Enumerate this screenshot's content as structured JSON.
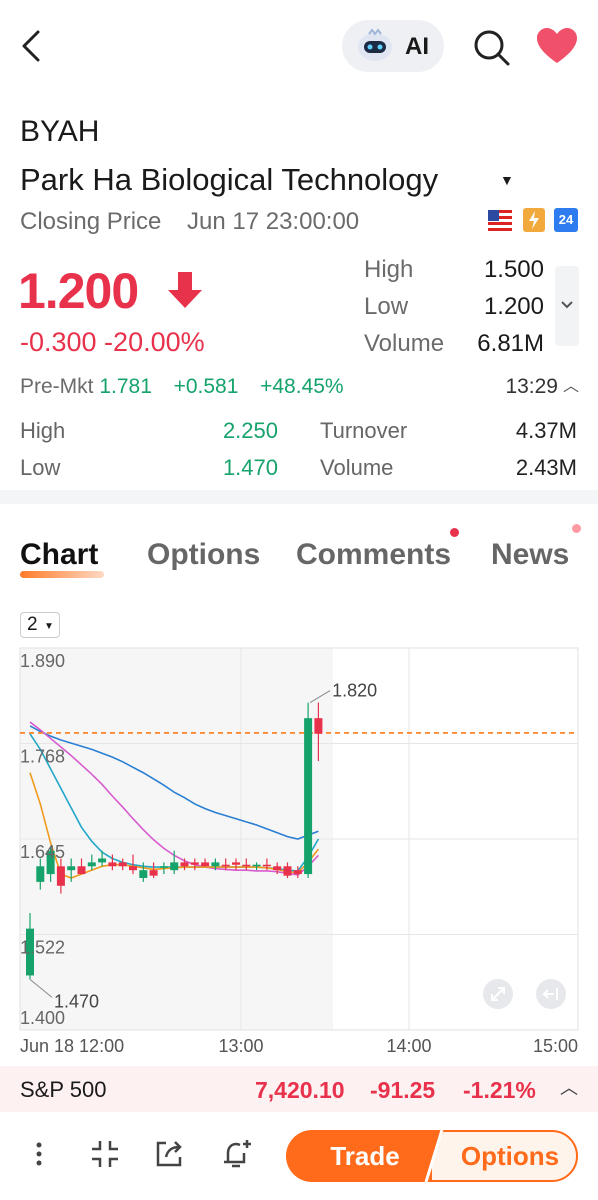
{
  "header": {
    "ai_label": "AI",
    "ticker": "BYAH",
    "company": "Park Ha Biological Technology",
    "closing_label": "Closing Price",
    "closing_time": "Jun 17 23:00:00",
    "badge_24": "24"
  },
  "quote": {
    "price": "1.200",
    "change": "-0.300 -20.00%",
    "high_label": "High",
    "high": "1.500",
    "low_label": "Low",
    "low": "1.200",
    "volume_label": "Volume",
    "volume": "6.81M"
  },
  "premarket": {
    "label": "Pre-Mkt",
    "price": "1.781",
    "change": "+0.581",
    "pct": "+48.45%",
    "time": "13:29",
    "high_label": "High",
    "high": "2.250",
    "low_label": "Low",
    "low": "1.470",
    "turnover_label": "Turnover",
    "turnover": "4.37M",
    "volume_label": "Volume",
    "volume": "2.43M"
  },
  "tabs": [
    "Chart",
    "Options",
    "Comments",
    "News"
  ],
  "period": "2",
  "chart_data": {
    "type": "candlestick",
    "y_ticks": [
      "1.890",
      "1.768",
      "1.645",
      "1.522",
      "1.400"
    ],
    "x_ticks": [
      "Jun 18 12:00",
      "13:00",
      "14:00",
      "15:00"
    ],
    "ylim": [
      1.4,
      1.89
    ],
    "annotations": {
      "max": "1.820",
      "min": "1.470"
    },
    "reference_line": 1.781,
    "candles": [
      {
        "o": 1.47,
        "h": 1.55,
        "l": 1.465,
        "c": 1.53
      },
      {
        "o": 1.59,
        "h": 1.62,
        "l": 1.58,
        "c": 1.61
      },
      {
        "o": 1.6,
        "h": 1.635,
        "l": 1.59,
        "c": 1.63
      },
      {
        "o": 1.61,
        "h": 1.62,
        "l": 1.575,
        "c": 1.585
      },
      {
        "o": 1.605,
        "h": 1.62,
        "l": 1.59,
        "c": 1.61
      },
      {
        "o": 1.61,
        "h": 1.62,
        "l": 1.6,
        "c": 1.6
      },
      {
        "o": 1.61,
        "h": 1.625,
        "l": 1.605,
        "c": 1.615
      },
      {
        "o": 1.615,
        "h": 1.63,
        "l": 1.61,
        "c": 1.62
      },
      {
        "o": 1.615,
        "h": 1.625,
        "l": 1.605,
        "c": 1.61
      },
      {
        "o": 1.615,
        "h": 1.62,
        "l": 1.605,
        "c": 1.61
      },
      {
        "o": 1.61,
        "h": 1.625,
        "l": 1.6,
        "c": 1.605
      },
      {
        "o": 1.595,
        "h": 1.615,
        "l": 1.59,
        "c": 1.605
      },
      {
        "o": 1.605,
        "h": 1.615,
        "l": 1.595,
        "c": 1.598
      },
      {
        "o": 1.61,
        "h": 1.615,
        "l": 1.6,
        "c": 1.61
      },
      {
        "o": 1.605,
        "h": 1.63,
        "l": 1.6,
        "c": 1.615
      },
      {
        "o": 1.615,
        "h": 1.62,
        "l": 1.605,
        "c": 1.61
      },
      {
        "o": 1.615,
        "h": 1.62,
        "l": 1.605,
        "c": 1.612
      },
      {
        "o": 1.615,
        "h": 1.62,
        "l": 1.61,
        "c": 1.61
      },
      {
        "o": 1.61,
        "h": 1.62,
        "l": 1.605,
        "c": 1.615
      },
      {
        "o": 1.612,
        "h": 1.62,
        "l": 1.605,
        "c": 1.61
      },
      {
        "o": 1.615,
        "h": 1.62,
        "l": 1.605,
        "c": 1.612
      },
      {
        "o": 1.612,
        "h": 1.62,
        "l": 1.605,
        "c": 1.61
      },
      {
        "o": 1.61,
        "h": 1.615,
        "l": 1.605,
        "c": 1.612
      },
      {
        "o": 1.612,
        "h": 1.62,
        "l": 1.605,
        "c": 1.61
      },
      {
        "o": 1.61,
        "h": 1.615,
        "l": 1.6,
        "c": 1.605
      },
      {
        "o": 1.61,
        "h": 1.615,
        "l": 1.595,
        "c": 1.598
      },
      {
        "o": 1.605,
        "h": 1.61,
        "l": 1.595,
        "c": 1.6
      },
      {
        "o": 1.6,
        "h": 1.82,
        "l": 1.595,
        "c": 1.8
      },
      {
        "o": 1.8,
        "h": 1.82,
        "l": 1.745,
        "c": 1.78
      }
    ],
    "series": [
      {
        "color": "#2a7fd4",
        "values": [
          1.79,
          1.783,
          1.777,
          1.772,
          1.768,
          1.764,
          1.76,
          1.755,
          1.75,
          1.744,
          1.737,
          1.73,
          1.722,
          1.714,
          1.705,
          1.698,
          1.69,
          1.684,
          1.679,
          1.675,
          1.671,
          1.667,
          1.663,
          1.658,
          1.653,
          1.648,
          1.645,
          1.65,
          1.655
        ]
      },
      {
        "color": "#d85bd0",
        "values": [
          1.795,
          1.785,
          1.774,
          1.763,
          1.752,
          1.74,
          1.728,
          1.715,
          1.7,
          1.686,
          1.671,
          1.657,
          1.644,
          1.633,
          1.624,
          1.617,
          1.612,
          1.609,
          1.607,
          1.606,
          1.605,
          1.605,
          1.604,
          1.604,
          1.603,
          1.601,
          1.599,
          1.61,
          1.624
        ]
      },
      {
        "color": "#22a7c9",
        "values": [
          1.78,
          1.76,
          1.735,
          1.71,
          1.685,
          1.66,
          1.642,
          1.628,
          1.62,
          1.615,
          1.612,
          1.61,
          1.609,
          1.609,
          1.609,
          1.609,
          1.609,
          1.609,
          1.609,
          1.609,
          1.609,
          1.609,
          1.609,
          1.608,
          1.607,
          1.605,
          1.604,
          1.622,
          1.645
        ]
      },
      {
        "color": "#f09a1c",
        "values": [
          1.73,
          1.69,
          1.64,
          1.6,
          1.595,
          1.6,
          1.605,
          1.61,
          1.612,
          1.612,
          1.61,
          1.608,
          1.606,
          1.607,
          1.608,
          1.609,
          1.609,
          1.609,
          1.609,
          1.609,
          1.609,
          1.609,
          1.609,
          1.608,
          1.606,
          1.603,
          1.602,
          1.615,
          1.632
        ]
      }
    ]
  },
  "index": {
    "name": "S&P 500",
    "value": "7,420.10",
    "change": "-91.25",
    "pct": "-1.21%"
  },
  "actions": {
    "trade": "Trade",
    "options": "Options"
  },
  "colors": {
    "up": "#16a36b",
    "down": "#e8314a",
    "accent": "#ff6b1a"
  }
}
